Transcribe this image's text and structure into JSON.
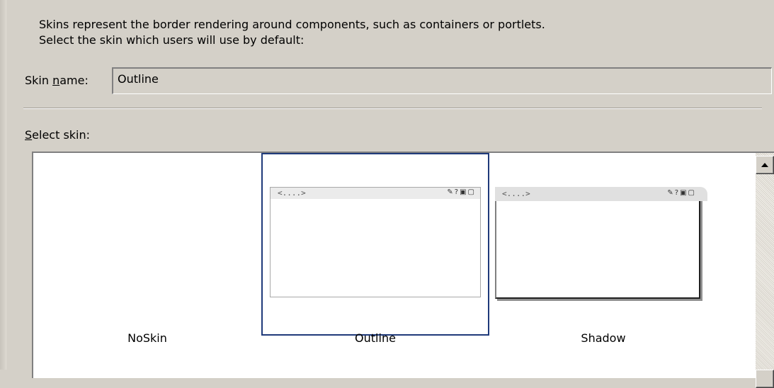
{
  "description": {
    "line1": "Skins represent the border rendering around components, such as containers or portlets.",
    "line2": "Select the skin which users will use by default:"
  },
  "skin_name": {
    "label_pre": "Skin ",
    "label_mnemonic": "n",
    "label_post": "ame:",
    "value": "Outline"
  },
  "select_skin": {
    "label_mnemonic": "S",
    "label_post": "elect skin:"
  },
  "skins": [
    {
      "label": "NoSkin",
      "selected": false
    },
    {
      "label": "Outline",
      "selected": true
    },
    {
      "label": "Shadow",
      "selected": false
    }
  ],
  "preview": {
    "title_text": "<....>",
    "title_glyphs": "✎?▣▢",
    "icons": [
      "edit-icon",
      "help-icon",
      "minimize-icon",
      "maximize-icon"
    ]
  },
  "colors": {
    "dialog_bg": "#d4d0c8",
    "list_bg": "#ffffff",
    "selection_border": "#1f3a7a"
  }
}
